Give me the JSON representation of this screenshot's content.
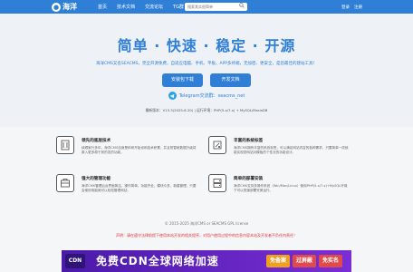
{
  "nav": {
    "logo_glyph": "●",
    "logo_text": "海洋",
    "links": [
      "首页",
      "技术文档",
      "交流论坛",
      "TG群"
    ],
    "search_placeholder": "搜索其实很简单",
    "search_icon": "search-icon",
    "login": "登录",
    "register": "注册"
  },
  "hero": {
    "title": "简单 · 快速 · 稳定 · 开源",
    "subtitle": "海洋CMS又名SEACMS，完全开源免费，自适应电脑、手机、平板、APP多终端，无加密、更安全，是您最佳的建站工具！",
    "download_button": "安装包下载",
    "dev_docs_button": "开发文档",
    "telegram_icon": "telegram-icon",
    "telegram_text": "Telegram交流群：seacms_net",
    "meta": "最新版本：V13.3(2025-6-20) | 运行环境：PHP(5.x/7.x) + MySQL/MariaDB"
  },
  "features": [
    {
      "icon": "layers-icon",
      "title": "领先的底层技术",
      "desc": "续艰家行多年，海洋CMS自身是科研开始设和技术积累，并且短暂继数据升级将原入更多原于其的发的功能。"
    },
    {
      "icon": "tag-icon",
      "title": "丰富的系统标签",
      "desc": "海洋CMS拥有丰富的系统标签，可以满足网站内容的各种需求，只要简单一改就能实现您网站对模板的个性化的功能设计。"
    },
    {
      "icon": "admin-icon",
      "title": "强大的管理功能",
      "desc": "海洋CMS管理后台界面简洁，操作简单，功能齐全，模块众多，新建管理，只要会使用电脑就可以轻松管理网站。"
    },
    {
      "icon": "server-icon",
      "title": "简单的部署安装",
      "desc": "海洋CMS支持多操作系统（Win/Mac/Linux）使用PHP(5.x/7.x)+MySQL环境下可以快速部署完美运行。"
    }
  ],
  "footer": {
    "copyright": "© 2015-2025 海洋CMS or SEACMS GPL license",
    "disclaimer": "声明：请在遵守法律前提下使用本站开发的相关程序，对用户使用过程中的信息内容本站及开发者不负任何责任！"
  },
  "ad": {
    "left_badge": "CDN",
    "headline": "免费CDN全球网络加速",
    "tags": [
      "免备案",
      "过屏蔽",
      "免实名"
    ],
    "colors": {
      "bg_start": "#4a1aa8",
      "bg_end": "#7a2ed6",
      "tag1": "#f0a020",
      "tag2": "#e04a4a",
      "tag3": "#e04a4a"
    }
  },
  "colors": {
    "brand": "#2f7fd6",
    "danger": "#d33",
    "hero_bg": "#eef2f6"
  }
}
